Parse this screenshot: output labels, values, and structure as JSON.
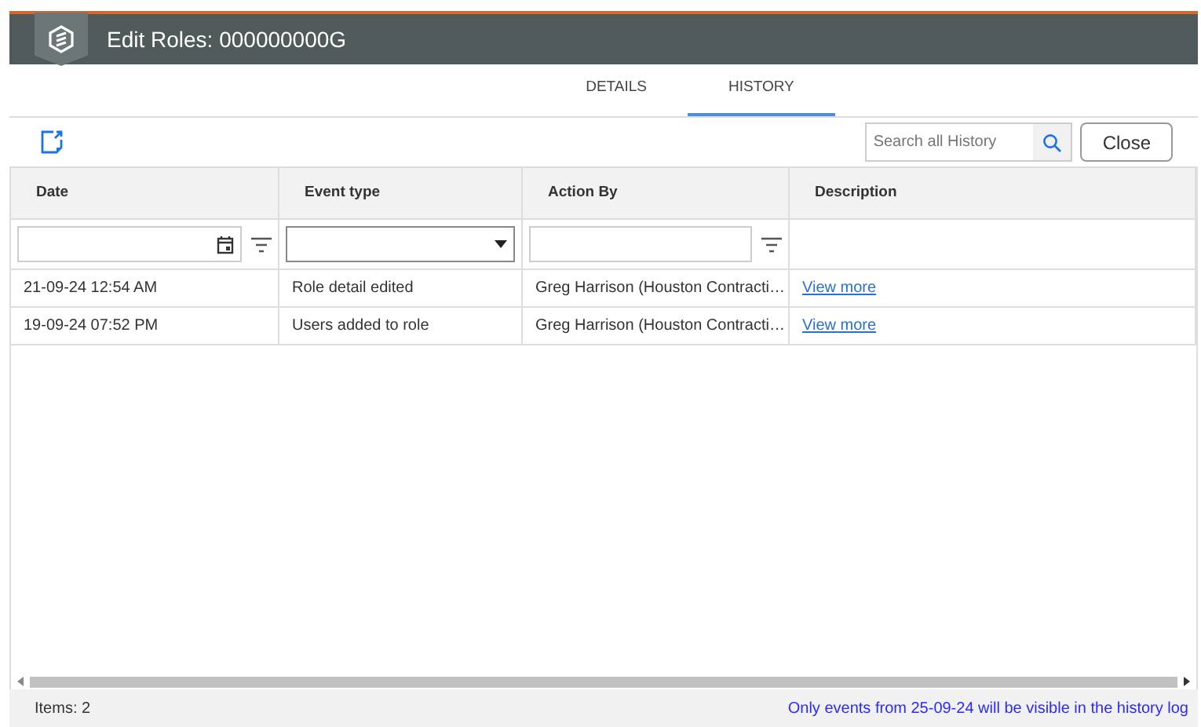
{
  "window": {
    "title": "Edit Roles: 000000000G"
  },
  "tabs": [
    {
      "label": "DETAILS",
      "selected": false
    },
    {
      "label": "HISTORY",
      "selected": true
    }
  ],
  "search": {
    "placeholder": "Search all History"
  },
  "close_button": "Close",
  "table": {
    "columns": [
      {
        "label": "Date",
        "kind": "date"
      },
      {
        "label": "Event type",
        "kind": "select"
      },
      {
        "label": "Action By",
        "kind": "text"
      },
      {
        "label": "Description",
        "kind": "plain"
      }
    ],
    "rows": [
      [
        "21-09-24 12:54 AM",
        "Role detail edited",
        "Greg Harrison (Houston Contracti…",
        "View more"
      ],
      [
        "19-09-24 07:52 PM",
        "Users added to role",
        "Greg Harrison (Houston Contracti…",
        "View more"
      ]
    ]
  },
  "status_bar": {
    "items": "Items: 2",
    "notice": "Only events from 25-09-24 will be visible in the history log"
  }
}
